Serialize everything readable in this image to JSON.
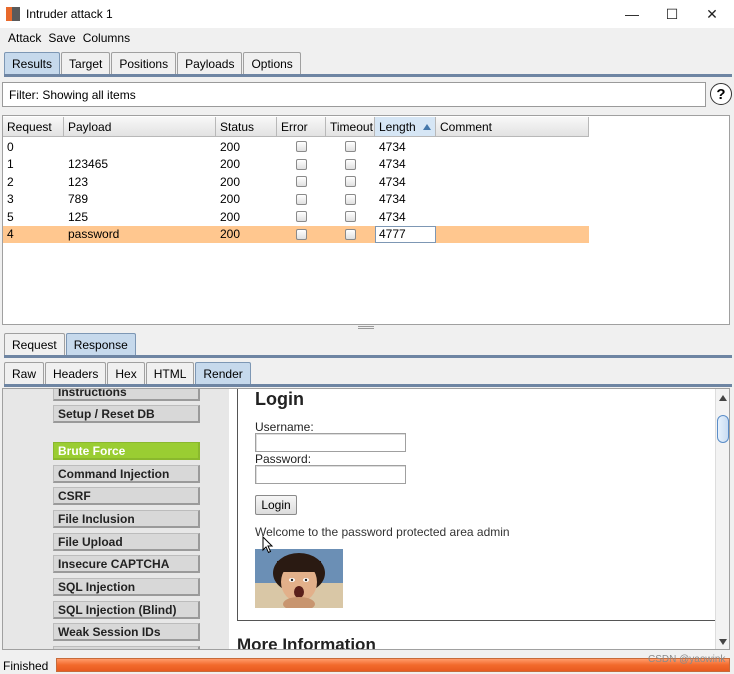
{
  "window": {
    "title": "Intruder attack 1",
    "controls": {
      "minimize": "—",
      "maximize": "☐",
      "close": "✕"
    }
  },
  "menu": [
    "Attack",
    "Save",
    "Columns"
  ],
  "tabs_main": [
    {
      "label": "Results",
      "active": true
    },
    {
      "label": "Target",
      "active": false
    },
    {
      "label": "Positions",
      "active": false
    },
    {
      "label": "Payloads",
      "active": false
    },
    {
      "label": "Options",
      "active": false
    }
  ],
  "filter": {
    "text": "Filter: Showing all items",
    "help": "?"
  },
  "table": {
    "columns": [
      "Request",
      "Payload",
      "Status",
      "Error",
      "Timeout",
      "Length",
      "Comment"
    ],
    "sorted_column": "Length",
    "rows": [
      {
        "request": "0",
        "payload": "",
        "status": "200",
        "error": false,
        "timeout": false,
        "length": "4734",
        "comment": ""
      },
      {
        "request": "1",
        "payload": "123465",
        "status": "200",
        "error": false,
        "timeout": false,
        "length": "4734",
        "comment": ""
      },
      {
        "request": "2",
        "payload": "123",
        "status": "200",
        "error": false,
        "timeout": false,
        "length": "4734",
        "comment": ""
      },
      {
        "request": "3",
        "payload": "789",
        "status": "200",
        "error": false,
        "timeout": false,
        "length": "4734",
        "comment": ""
      },
      {
        "request": "5",
        "payload": "125",
        "status": "200",
        "error": false,
        "timeout": false,
        "length": "4734",
        "comment": ""
      },
      {
        "request": "4",
        "payload": "password",
        "status": "200",
        "error": false,
        "timeout": false,
        "length": "4777",
        "comment": "",
        "highlighted": true
      }
    ]
  },
  "tabs_reqresp": [
    {
      "label": "Request",
      "active": false
    },
    {
      "label": "Response",
      "active": true
    }
  ],
  "tabs_view": [
    {
      "label": "Raw",
      "active": false
    },
    {
      "label": "Headers",
      "active": false
    },
    {
      "label": "Hex",
      "active": false
    },
    {
      "label": "HTML",
      "active": false
    },
    {
      "label": "Render",
      "active": true
    }
  ],
  "render": {
    "menu": [
      {
        "label": "Instructions",
        "selected": false
      },
      {
        "label": "Setup / Reset DB",
        "selected": false
      },
      {
        "label": "Brute Force",
        "selected": true
      },
      {
        "label": "Command Injection",
        "selected": false
      },
      {
        "label": "CSRF",
        "selected": false
      },
      {
        "label": "File Inclusion",
        "selected": false
      },
      {
        "label": "File Upload",
        "selected": false
      },
      {
        "label": "Insecure CAPTCHA",
        "selected": false
      },
      {
        "label": "SQL Injection",
        "selected": false
      },
      {
        "label": "SQL Injection (Blind)",
        "selected": false
      },
      {
        "label": "Weak Session IDs",
        "selected": false
      }
    ],
    "login_title": "Login",
    "username_label": "Username:",
    "password_label": "Password:",
    "login_button": "Login",
    "welcome": "Welcome to the password protected area admin",
    "more_info": "More Information",
    "accent": "#9acd32"
  },
  "status": {
    "text": "Finished",
    "progress": 1.0
  },
  "watermark": "CSDN @yaowink"
}
